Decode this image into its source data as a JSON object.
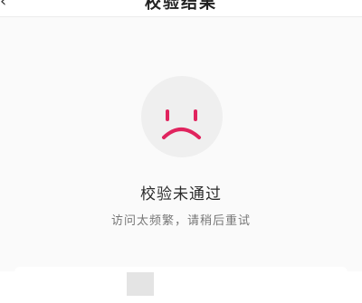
{
  "header": {
    "back_icon": "chevron-left-icon",
    "title": "校验结果"
  },
  "result": {
    "icon": "sad-face-icon",
    "icon_color": "#e0245e",
    "status": "校验未通过",
    "hint": "访问太频繁，请稍后重试"
  },
  "card": {
    "label": "",
    "value": ""
  }
}
